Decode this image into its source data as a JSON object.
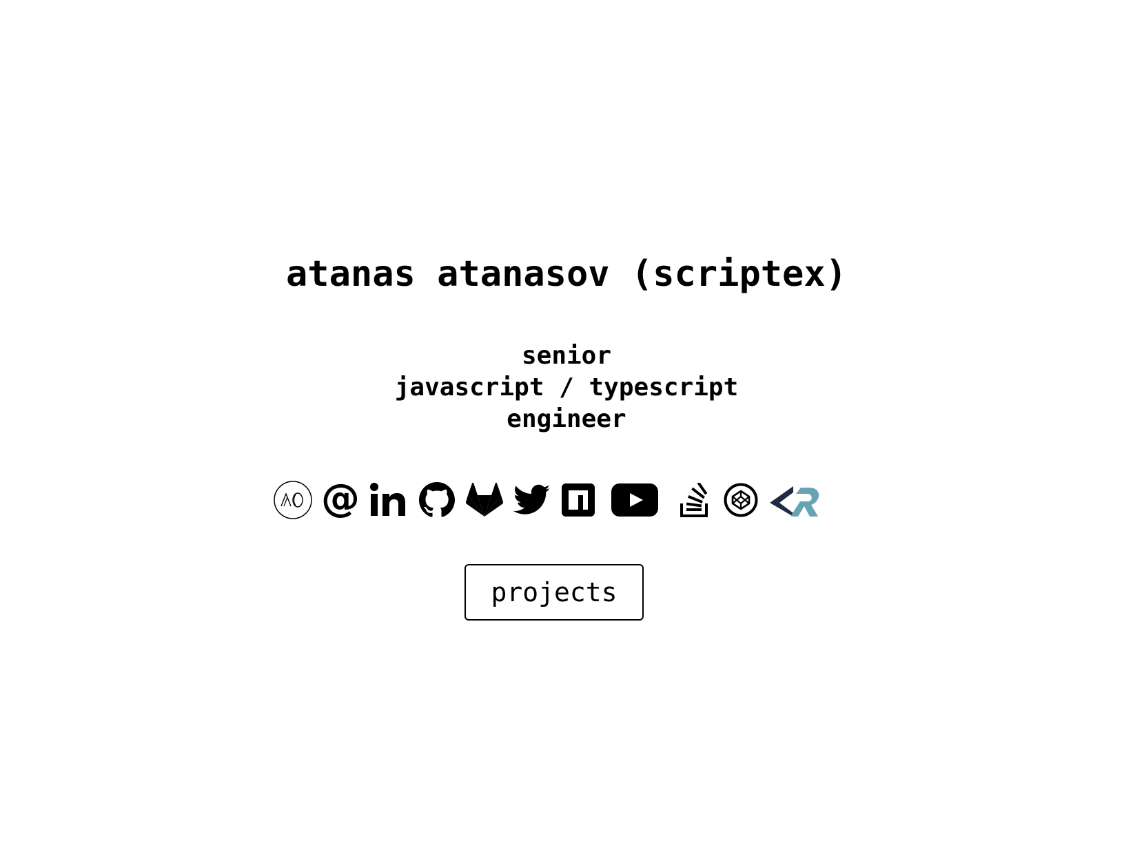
{
  "header": {
    "name": "atanas atanasov (scriptex)"
  },
  "role": {
    "line1": "senior",
    "line2": "javascript / typescript",
    "line3": "engineer"
  },
  "social_links": [
    {
      "icon": "personal-logo-icon"
    },
    {
      "icon": "email-at-icon"
    },
    {
      "icon": "linkedin-icon"
    },
    {
      "icon": "github-icon"
    },
    {
      "icon": "gitlab-icon"
    },
    {
      "icon": "twitter-icon"
    },
    {
      "icon": "npm-icon"
    },
    {
      "icon": "youtube-icon"
    },
    {
      "icon": "stackoverflow-icon"
    },
    {
      "icon": "codepen-icon"
    },
    {
      "icon": "codersrank-icon"
    }
  ],
  "colors": {
    "text": "#000000",
    "background": "#ffffff",
    "codersrank_dark": "#1f2a44",
    "codersrank_light": "#67a4b3"
  },
  "actions": {
    "projects_label": "projects"
  }
}
